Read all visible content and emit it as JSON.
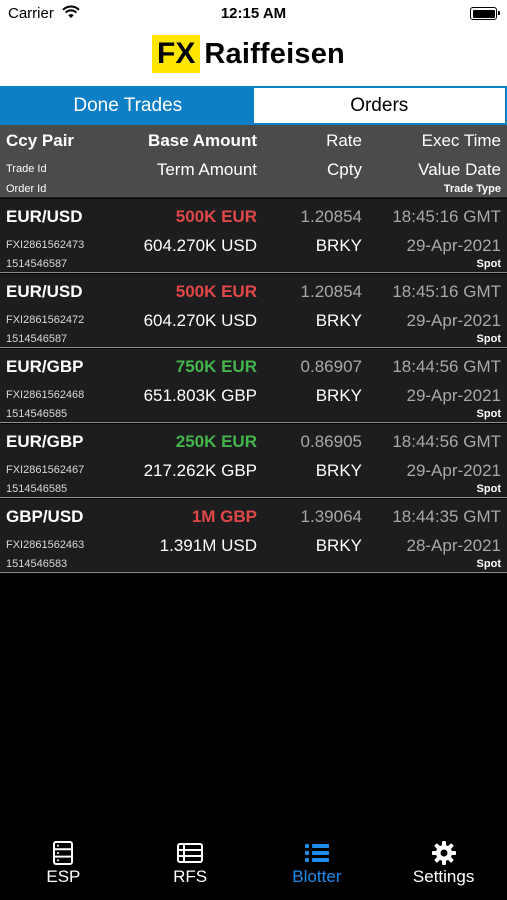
{
  "status": {
    "carrier": "Carrier",
    "time": "12:15 AM"
  },
  "brand": {
    "logo_fx": "FX",
    "logo_name": "Raiffeisen"
  },
  "tabs": [
    {
      "label": "Done Trades",
      "active": true
    },
    {
      "label": "Orders",
      "active": false
    }
  ],
  "header": {
    "ccy_pair": "Ccy Pair",
    "base_amount": "Base Amount",
    "rate": "Rate",
    "exec_time": "Exec Time",
    "trade_id": "Trade Id",
    "term_amount": "Term Amount",
    "cpty": "Cpty",
    "value_date": "Value Date",
    "order_id": "Order Id",
    "trade_type": "Trade Type"
  },
  "trades": [
    {
      "pair": "EUR/USD",
      "base_amount": "500K EUR",
      "base_dir": "sell",
      "rate": "1.20854",
      "exec_time": "18:45:16 GMT",
      "trade_id": "FXI2861562473",
      "term_amount": "604.270K USD",
      "cpty": "BRKY",
      "value_date": "29-Apr-2021",
      "order_id": "1514546587",
      "trade_type": "Spot"
    },
    {
      "pair": "EUR/USD",
      "base_amount": "500K EUR",
      "base_dir": "sell",
      "rate": "1.20854",
      "exec_time": "18:45:16 GMT",
      "trade_id": "FXI2861562472",
      "term_amount": "604.270K USD",
      "cpty": "BRKY",
      "value_date": "29-Apr-2021",
      "order_id": "1514546587",
      "trade_type": "Spot"
    },
    {
      "pair": "EUR/GBP",
      "base_amount": "750K EUR",
      "base_dir": "buy",
      "rate": "0.86907",
      "exec_time": "18:44:56 GMT",
      "trade_id": "FXI2861562468",
      "term_amount": "651.803K GBP",
      "cpty": "BRKY",
      "value_date": "29-Apr-2021",
      "order_id": "1514546585",
      "trade_type": "Spot"
    },
    {
      "pair": "EUR/GBP",
      "base_amount": "250K EUR",
      "base_dir": "buy",
      "rate": "0.86905",
      "exec_time": "18:44:56 GMT",
      "trade_id": "FXI2861562467",
      "term_amount": "217.262K GBP",
      "cpty": "BRKY",
      "value_date": "29-Apr-2021",
      "order_id": "1514546585",
      "trade_type": "Spot"
    },
    {
      "pair": "GBP/USD",
      "base_amount": "1M GBP",
      "base_dir": "sell",
      "rate": "1.39064",
      "exec_time": "18:44:35 GMT",
      "trade_id": "FXI2861562463",
      "term_amount": "1.391M USD",
      "cpty": "BRKY",
      "value_date": "28-Apr-2021",
      "order_id": "1514546583",
      "trade_type": "Spot"
    }
  ],
  "colors": {
    "accent": "#0d7fc6",
    "sell": "#e04848",
    "buy": "#43b54a",
    "logo_yellow": "#ffe600",
    "tab_active": "#1d8bf0"
  },
  "tabbar": [
    {
      "label": "ESP",
      "icon": "server-icon",
      "active": false
    },
    {
      "label": "RFS",
      "icon": "list-box-icon",
      "active": false
    },
    {
      "label": "Blotter",
      "icon": "list-icon",
      "active": true
    },
    {
      "label": "Settings",
      "icon": "gear-icon",
      "active": false
    }
  ]
}
